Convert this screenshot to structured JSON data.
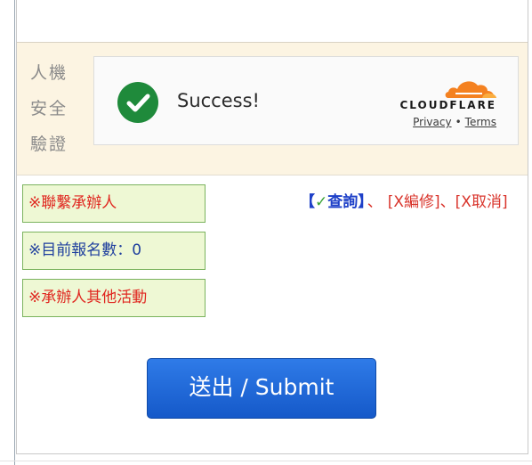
{
  "verify": {
    "label_lines": [
      "人機",
      "安全",
      "驗證"
    ],
    "widget": {
      "status_icon": "check-circle-icon",
      "status_text": "Success!",
      "brand": "CLOUDFLARE",
      "privacy_link": "Privacy",
      "link_separator": "•",
      "terms_link": "Terms"
    }
  },
  "fields": [
    {
      "label": "※聯繫承辦人",
      "color": "#e0261f"
    },
    {
      "label": "※目前報名數：0",
      "color": "#1f3f9e"
    },
    {
      "label": "※承辦人其他活動",
      "color": "#e0261f"
    }
  ],
  "actions": {
    "open_bracket": "【",
    "check_mark": "✓",
    "query": "查詢",
    "close_bracket": "】",
    "separator": "、",
    "edit": "[X編修]",
    "separator2": "、",
    "cancel": "[X取消]"
  },
  "submit": {
    "label": "送出 / Submit"
  },
  "colors": {
    "band_bg": "#fcf4e2",
    "field_bg": "#eef8d4",
    "field_border": "#7bb35e",
    "button_blue": "#1f6ad8",
    "cloudflare_orange": "#f48120"
  }
}
